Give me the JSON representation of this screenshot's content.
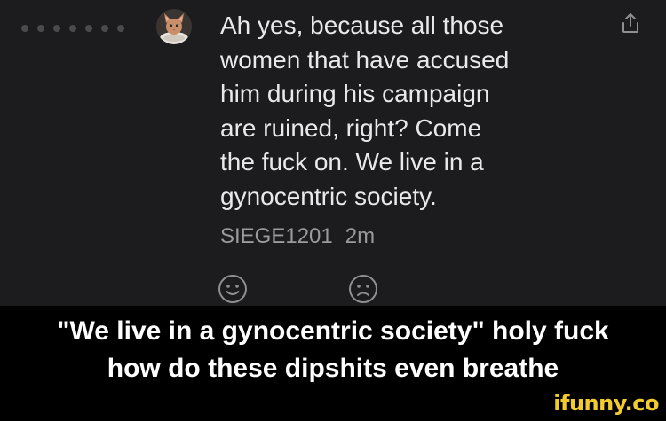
{
  "comment": {
    "text": "Ah yes, because all those\nwomen that have accused\nhim during his campaign\nare ruined, right? Come\nthe fuck on. We live in a\ngynocentric society.",
    "username": "SIEGE1201",
    "timestamp": "2m",
    "avatar_icon": "cat-avatar-icon",
    "share_icon": "share-icon",
    "reactions": [
      "smiley-face-icon",
      "frowny-face-icon"
    ]
  },
  "caption": "\"We live in a gynocentric society\" holy fuck\nhow do these dipshits even breathe",
  "watermark": "ifunny.co",
  "colors": {
    "panel_background": "#1c1c1e",
    "page_background": "#000000",
    "text_primary": "#e9e9ea",
    "text_secondary": "#9a9a9f",
    "watermark": "#f2cc2f"
  }
}
